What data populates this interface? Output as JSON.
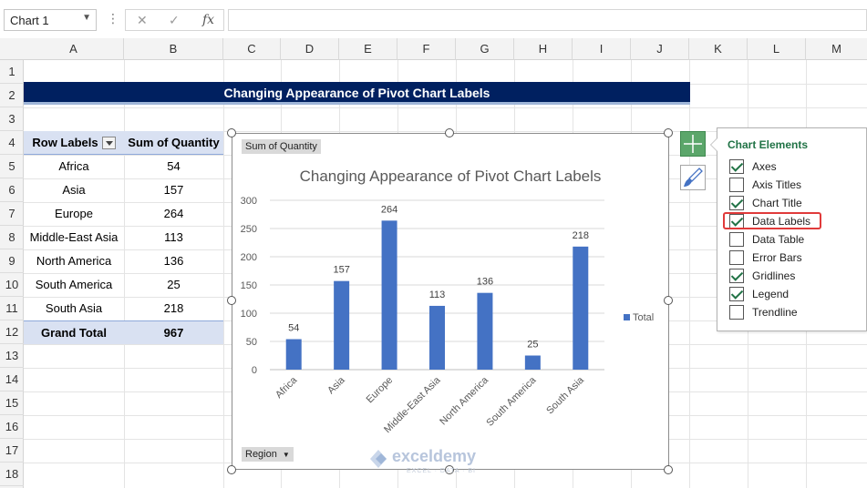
{
  "formula_bar": {
    "name_box": "Chart 1",
    "cancel_icon": "✕",
    "enter_icon": "✓",
    "fx_label": "fx",
    "formula": ""
  },
  "columns": [
    "A",
    "B",
    "C",
    "D",
    "E",
    "F",
    "G",
    "H",
    "I",
    "J",
    "K",
    "L",
    "M"
  ],
  "rows": [
    "1",
    "2",
    "3",
    "4",
    "5",
    "6",
    "7",
    "8",
    "9",
    "10",
    "11",
    "12",
    "13",
    "14",
    "15",
    "16",
    "17",
    "18"
  ],
  "banner_title": "Changing Appearance of Pivot Chart Labels",
  "pivot": {
    "header": {
      "label": "Row Labels",
      "value": "Sum of Quantity"
    },
    "rows": [
      {
        "label": "Africa",
        "value": "54"
      },
      {
        "label": "Asia",
        "value": "157"
      },
      {
        "label": "Europe",
        "value": "264"
      },
      {
        "label": "Middle-East Asia",
        "value": "113"
      },
      {
        "label": "North America",
        "value": "136"
      },
      {
        "label": "South America",
        "value": "25"
      },
      {
        "label": "South Asia",
        "value": "218"
      }
    ],
    "total": {
      "label": "Grand Total",
      "value": "967"
    }
  },
  "chart_buttons": {
    "value_field": "Sum of Quantity",
    "axis_field": "Region"
  },
  "chart_data": {
    "type": "bar",
    "title": "Changing Appearance of Pivot Chart Labels",
    "categories": [
      "Africa",
      "Asia",
      "Europe",
      "Middle-East Asia",
      "North America",
      "South America",
      "South Asia"
    ],
    "series": [
      {
        "name": "Total",
        "values": [
          54,
          157,
          264,
          113,
          136,
          25,
          218
        ],
        "color": "#4472c4"
      }
    ],
    "yticks": [
      "0",
      "50",
      "100",
      "150",
      "200",
      "250",
      "300"
    ],
    "ylim": [
      0,
      300
    ],
    "grid": true,
    "legend": "right",
    "data_labels": true
  },
  "chart_elements": {
    "title": "Chart Elements",
    "items": [
      {
        "label": "Axes",
        "checked": true
      },
      {
        "label": "Axis Titles",
        "checked": false
      },
      {
        "label": "Chart Title",
        "checked": true
      },
      {
        "label": "Data Labels",
        "checked": true
      },
      {
        "label": "Data Table",
        "checked": false
      },
      {
        "label": "Error Bars",
        "checked": false
      },
      {
        "label": "Gridlines",
        "checked": true
      },
      {
        "label": "Legend",
        "checked": true
      },
      {
        "label": "Trendline",
        "checked": false
      }
    ],
    "highlighted": "Data Labels"
  },
  "watermark": {
    "brand": "exceldemy",
    "tagline": "EXCEL · DATA · BI"
  }
}
